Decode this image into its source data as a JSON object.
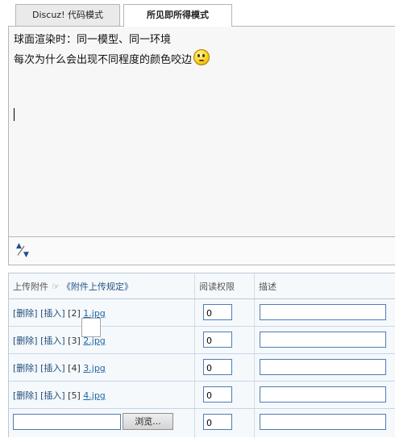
{
  "tabs": [
    {
      "label": "Discuz! 代码模式"
    },
    {
      "label": "所见即所得模式"
    }
  ],
  "editor": {
    "lines": [
      "球面渲染时：同一模型、同一环境",
      "每次为什么会出现不同程度的颜色咬边"
    ],
    "emoji": "confused-smiley-icon"
  },
  "attachments": {
    "headers": {
      "upload": "上传附件",
      "rules": "《附件上传规定》",
      "permission": "阅读权限",
      "description": "描述"
    },
    "rows": [
      {
        "actions": "[删除] [插入]",
        "index": "[2]",
        "file": "1.jpg",
        "permission": "0",
        "description": ""
      },
      {
        "actions": "[删除] [插入]",
        "index": "[3]",
        "file": "2.jpg",
        "permission": "0",
        "description": ""
      },
      {
        "actions": "[删除] [插入]",
        "index": "[4]",
        "file": "3.jpg",
        "permission": "0",
        "description": ""
      },
      {
        "actions": "[删除] [插入]",
        "index": "[5]",
        "file": "4.jpg",
        "permission": "0",
        "description": ""
      }
    ],
    "new_row": {
      "browse_label": "浏览...",
      "permission": "0",
      "file_value": "",
      "description": ""
    }
  },
  "colors": {
    "link": "#1f66a6",
    "input_border": "#4f7bb4",
    "table_bg": "#f5f9fc"
  }
}
